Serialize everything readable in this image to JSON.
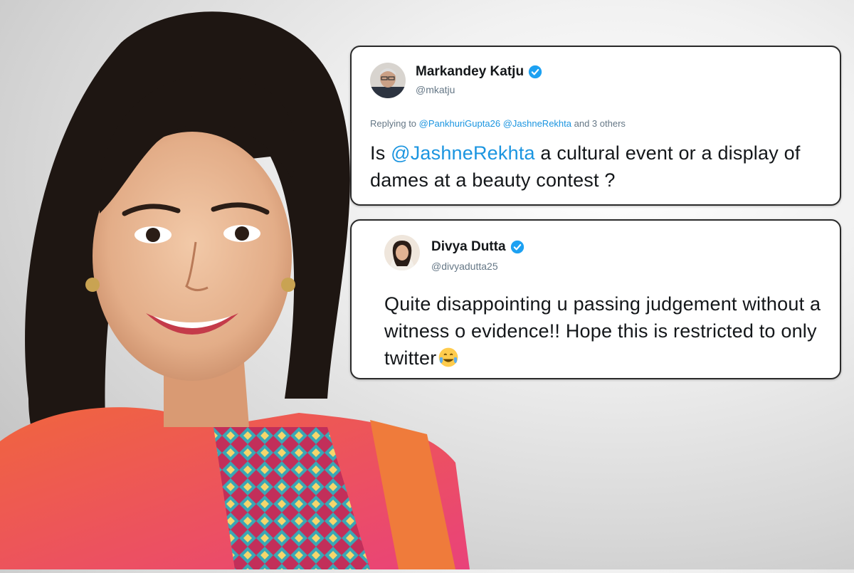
{
  "tweets": [
    {
      "name": "Markandey Katju",
      "handle": "@mkatju",
      "replying_prefix": "Replying to",
      "replying_mentions": [
        "@PankhuriGupta26",
        "@JashneRekhta"
      ],
      "replying_suffix": "and 3 others",
      "text_before": "Is ",
      "text_mention": "@JashneRekhta",
      "text_after": " a cultural event or a display of dames at a beauty contest ?",
      "verified": true
    },
    {
      "name": "Divya Dutta",
      "handle": "@divyadutta25",
      "text": "Quite disappointing u passing judgement without a witness o evidence!! Hope this is restricted to only twitter",
      "emoji": "face-with-tears-of-joy",
      "verified": true
    }
  ],
  "colors": {
    "link": "#1b95e0",
    "verified": "#1da1f2",
    "name": "#14171a",
    "muted": "#657786"
  }
}
